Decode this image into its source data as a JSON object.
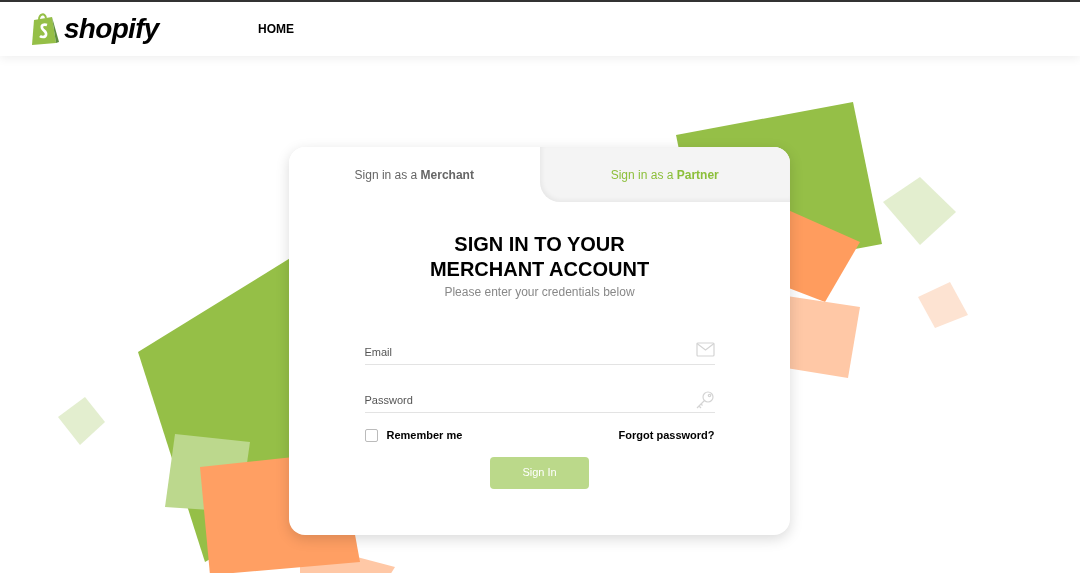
{
  "header": {
    "logo_text": "shopify",
    "nav": [
      {
        "label": "HOME"
      }
    ]
  },
  "tabs": [
    {
      "label": "Sign in as a **Merchant**",
      "selected": true
    },
    {
      "label": "Sign in as a **Partner**",
      "selected": false
    }
  ],
  "form": {
    "title_lines": [
      "SIGN IN TO YOUR",
      "MERCHANT ACCOUNT"
    ],
    "subtitle": "Please enter your credentials below",
    "fields": [
      {
        "kind": "email",
        "placeholder": "Email"
      },
      {
        "kind": "password",
        "placeholder": "Password"
      }
    ],
    "remember": {
      "label": "Remember me",
      "checked": false
    },
    "forgot_link": "Forgot password?",
    "submit": {
      "label": "Sign In",
      "disabled": true
    }
  }
}
